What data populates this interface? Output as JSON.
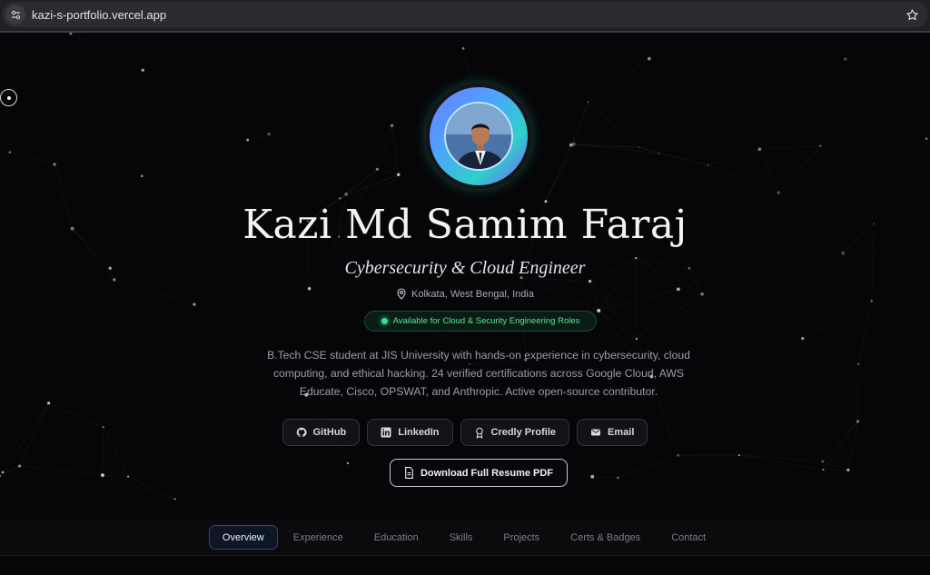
{
  "browser": {
    "url": "kazi-s-portfolio.vercel.app"
  },
  "profile": {
    "name": "Kazi Md Samim Faraj",
    "role": "Cybersecurity & Cloud Engineer",
    "location": "Kolkata, West Bengal, India",
    "availability": "Available for Cloud & Security Engineering Roles",
    "bio": "B.Tech CSE student at JIS University with hands-on experience in cybersecurity, cloud computing, and ethical hacking. 24 verified certifications across Google Cloud, AWS Educate, Cisco, OPSWAT, and Anthropic. Active open-source contributor."
  },
  "links": [
    {
      "label": "GitHub",
      "icon": "github-icon"
    },
    {
      "label": "LinkedIn",
      "icon": "linkedin-icon"
    },
    {
      "label": "Credly Profile",
      "icon": "badge-icon"
    },
    {
      "label": "Email",
      "icon": "mail-icon"
    }
  ],
  "resume_label": "Download Full Resume PDF",
  "nav": [
    {
      "label": "Overview",
      "active": true
    },
    {
      "label": "Experience",
      "active": false
    },
    {
      "label": "Education",
      "active": false
    },
    {
      "label": "Skills",
      "active": false
    },
    {
      "label": "Projects",
      "active": false
    },
    {
      "label": "Certs & Badges",
      "active": false
    },
    {
      "label": "Contact",
      "active": false
    }
  ],
  "colors": {
    "background": "#060608",
    "accent_green": "#3fdc8c",
    "avatar_gradient": [
      "#6f7bff",
      "#4ea1ff",
      "#2fd0c8",
      "#7a5cff"
    ],
    "active_nav_border": "#2f4a6b"
  }
}
